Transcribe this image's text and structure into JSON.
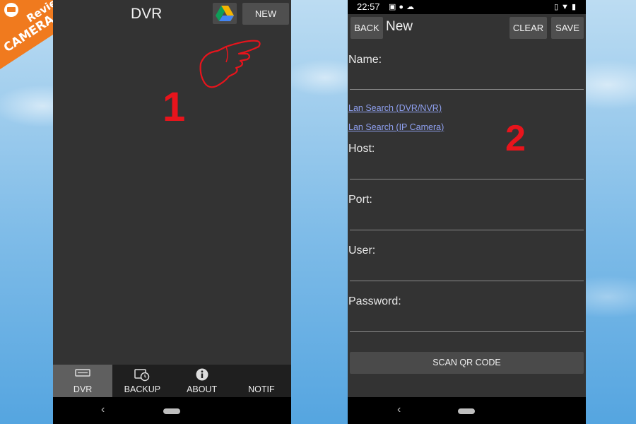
{
  "watermark": {
    "line1": "Review",
    "line2": "CAMERA.Net"
  },
  "phone1": {
    "title": "DVR",
    "new_button": "NEW",
    "annotation_number": "1",
    "tabs": [
      {
        "label": "DVR",
        "icon": "dvr-icon",
        "active": true
      },
      {
        "label": "BACKUP",
        "icon": "backup-clock-icon",
        "active": false
      },
      {
        "label": "ABOUT",
        "icon": "info-icon",
        "active": false
      },
      {
        "label": "NOTIF",
        "icon": "",
        "active": false
      }
    ],
    "nav": {
      "back_glyph": "‹"
    }
  },
  "phone2": {
    "status": {
      "time": "22:57"
    },
    "back_button": "BACK",
    "title": "New",
    "clear_button": "CLEAR",
    "save_button": "SAVE",
    "annotation_number": "2",
    "fields": {
      "name": "Name:",
      "host": "Host:",
      "port": "Port:",
      "user": "User:",
      "password": "Password:"
    },
    "links": {
      "lan_dvr": "Lan Search (DVR/NVR)",
      "lan_ip": "Lan Search (IP Camera)"
    },
    "scan_button": "SCAN QR CODE",
    "nav": {
      "back_glyph": "‹"
    }
  },
  "colors": {
    "annotation_red": "#e8141c",
    "link": "#8fa0f0",
    "screen_bg": "#333333"
  }
}
